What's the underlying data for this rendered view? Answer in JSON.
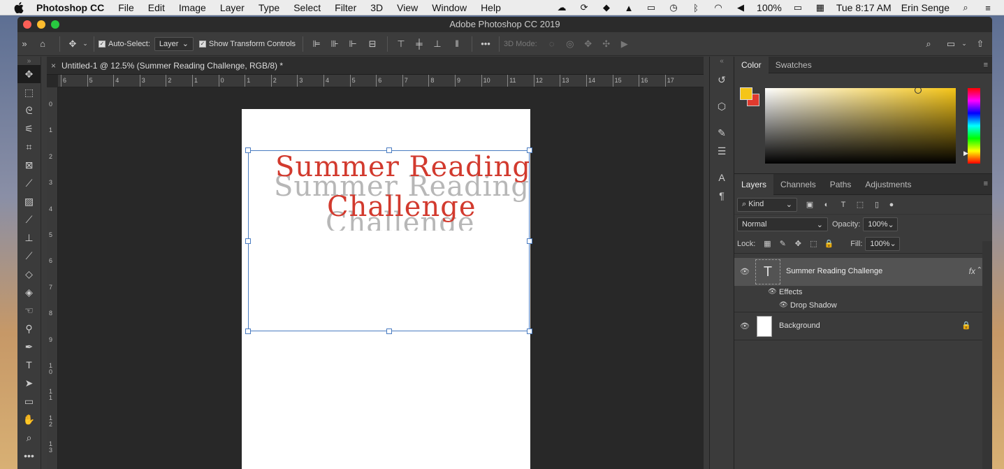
{
  "menubar": {
    "app": "Photoshop CC",
    "items": [
      "File",
      "Edit",
      "Image",
      "Layer",
      "Type",
      "Select",
      "Filter",
      "3D",
      "View",
      "Window",
      "Help"
    ],
    "battery": "100%",
    "clock": "Tue 8:17 AM",
    "user": "Erin Senge"
  },
  "window": {
    "title": "Adobe Photoshop CC 2019"
  },
  "options": {
    "auto_select_label": "Auto-Select:",
    "auto_select_value": "Layer",
    "show_transform": "Show Transform Controls",
    "mode3d": "3D Mode:"
  },
  "doc": {
    "tab": "Untitled-1 @ 12.5% (Summer Reading  Challenge, RGB/8) *",
    "line1": "Summer Reading",
    "line2": "Challenge"
  },
  "ruler": {
    "h": [
      "6",
      "5",
      "4",
      "3",
      "2",
      "1",
      "0",
      "1",
      "2",
      "3",
      "4",
      "5",
      "6",
      "7",
      "8",
      "9",
      "10",
      "11",
      "12",
      "13",
      "14",
      "15",
      "16",
      "17"
    ],
    "v": [
      "0",
      "1",
      "2",
      "3",
      "4",
      "5",
      "6",
      "7",
      "8",
      "9",
      "1 0",
      "1 1",
      "1 2",
      "1 3"
    ]
  },
  "color_panel": {
    "tabs": [
      "Color",
      "Swatches"
    ],
    "fg": "#f5c518",
    "bg": "#e03a2e"
  },
  "layers_panel": {
    "tabs": [
      "Layers",
      "Channels",
      "Paths",
      "Adjustments"
    ],
    "kind": "Kind",
    "blend": "Normal",
    "opacity_label": "Opacity:",
    "opacity": "100%",
    "lock_label": "Lock:",
    "fill_label": "Fill:",
    "fill": "100%",
    "layers": [
      {
        "name": "Summer Reading  Challenge",
        "fx": "fx"
      },
      {
        "name": "Effects"
      },
      {
        "name": "Drop Shadow"
      },
      {
        "name": "Background"
      }
    ]
  }
}
